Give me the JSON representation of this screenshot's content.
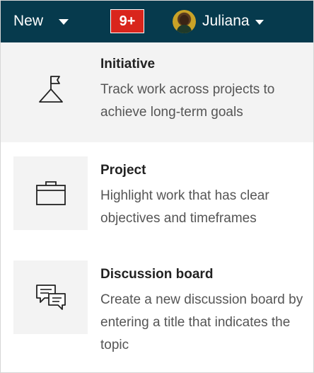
{
  "topbar": {
    "new_label": "New",
    "notification_count": "9+",
    "user_name": "Juliana"
  },
  "menu": {
    "items": [
      {
        "title": "Initiative",
        "description": "Track work across projects to achieve long-term goals",
        "icon": "flag-on-hill-icon"
      },
      {
        "title": "Project",
        "description": "Highlight work that has clear objectives and timeframes",
        "icon": "briefcase-icon"
      },
      {
        "title": "Discussion board",
        "description": "Create a new discussion board by entering a title that indicates the topic",
        "icon": "chat-bubbles-icon"
      }
    ]
  },
  "colors": {
    "topbar_bg": "#063a4d",
    "notification_bg": "#d9251c",
    "highlight_bg": "#f3f3f3"
  }
}
